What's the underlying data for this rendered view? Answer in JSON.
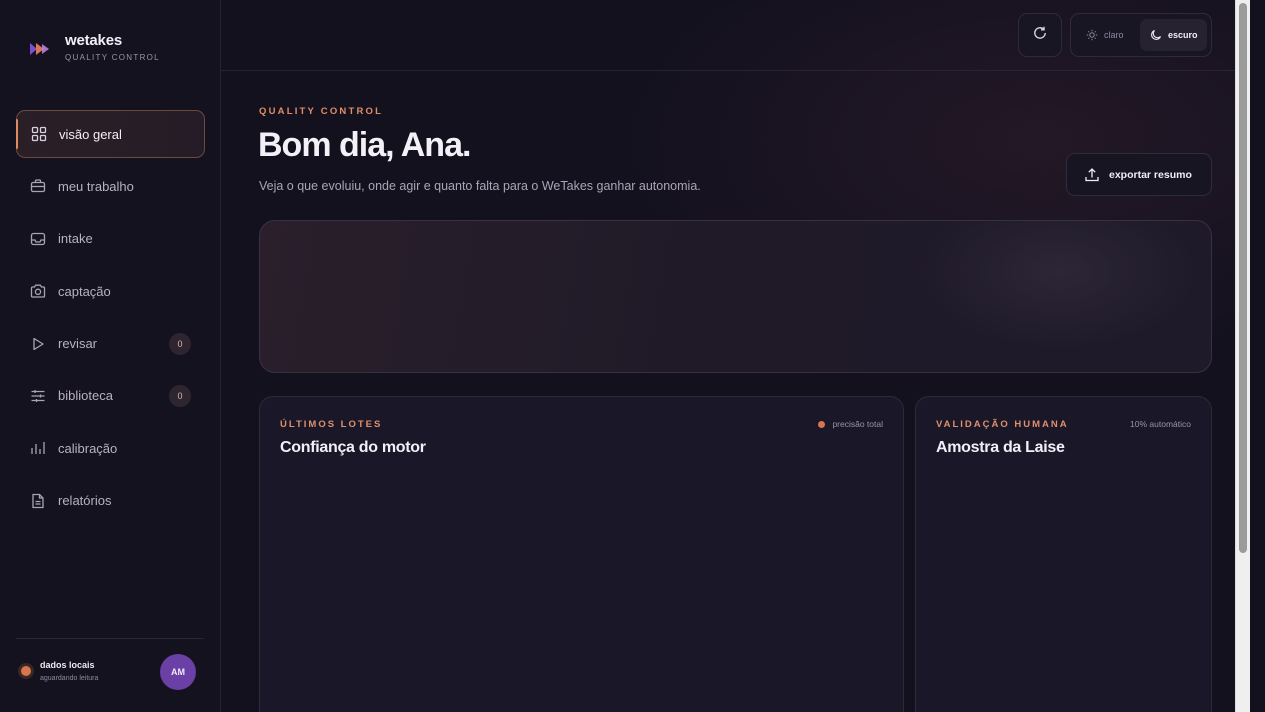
{
  "brand": {
    "name": "wetakes",
    "subtitle": "QUALITY CONTROL",
    "logo_icon": "play-chevrons-logo"
  },
  "sidebar": {
    "items": [
      {
        "label": "visão geral",
        "icon": "grid-icon",
        "active": true
      },
      {
        "label": "meu trabalho",
        "icon": "briefcase-icon"
      },
      {
        "label": "intake",
        "icon": "inbox-icon"
      },
      {
        "label": "captação",
        "icon": "camera-icon"
      },
      {
        "label": "revisar",
        "icon": "play-icon",
        "badge": "0"
      },
      {
        "label": "biblioteca",
        "icon": "sliders-icon",
        "badge": "0"
      },
      {
        "label": "calibração",
        "icon": "bar-chart-icon"
      },
      {
        "label": "relatórios",
        "icon": "file-icon"
      }
    ],
    "footer": {
      "status_title": "dados locais",
      "status_subtitle": "aguardando leitura",
      "avatar_initials": "AM"
    }
  },
  "topbar": {
    "theme": {
      "light_label": "claro",
      "dark_label": "escuro",
      "selected": "escuro"
    }
  },
  "header": {
    "eyebrow": "QUALITY CONTROL",
    "greeting": "Bom dia, Ana.",
    "subtitle": "Veja o que evoluiu, onde agir e quanto falta para o WeTakes ganhar autonomia.",
    "export_label": "exportar resumo"
  },
  "panels": {
    "lots": {
      "eyebrow": "ÚLTIMOS LOTES",
      "title": "Confiança do motor",
      "legend": "precisão total"
    },
    "validation": {
      "eyebrow": "VALIDAÇÃO HUMANA",
      "title": "Amostra da Laise",
      "meta": "10% automático"
    }
  },
  "colors": {
    "accent": "#e08d68",
    "background": "#14111f",
    "avatar": "#6a3fa6"
  }
}
